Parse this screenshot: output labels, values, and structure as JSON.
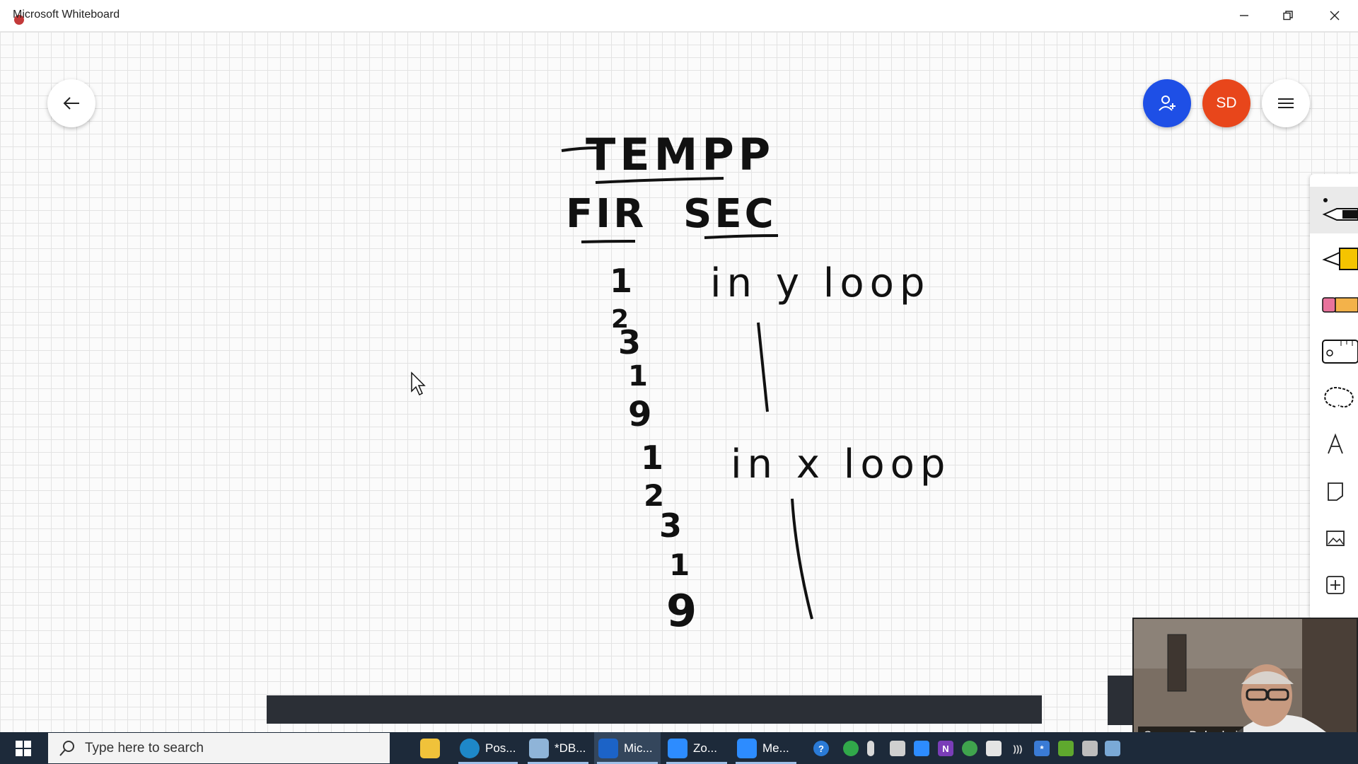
{
  "window": {
    "title": "Microsoft Whiteboard"
  },
  "canvas": {
    "ink": {
      "heading": "TEMPP",
      "col1": "FIR",
      "col2": "SEC",
      "y_loop_label": "in y loop",
      "x_loop_label": "in x loop",
      "values": [
        "1",
        "2",
        "3",
        "1",
        "9",
        "1",
        "2",
        "3",
        "1",
        "9"
      ]
    }
  },
  "top_controls": {
    "back_icon": "arrow-left-icon",
    "invite_icon": "person-add-icon",
    "avatar_initials": "SD",
    "menu_icon": "hamburger-icon"
  },
  "toolbar": {
    "tools": [
      "pen",
      "highlighter",
      "eraser",
      "ruler",
      "lasso",
      "text",
      "note",
      "image",
      "insert"
    ]
  },
  "video": {
    "participant_name": "Sameer Dehadrai"
  },
  "taskbar": {
    "search_placeholder": "Type here to search",
    "apps": [
      {
        "label": "Pos...",
        "icon": "edge-icon"
      },
      {
        "label": "*DB...",
        "icon": "notepad-icon"
      },
      {
        "label": "Mic...",
        "icon": "whiteboard-icon",
        "active": true
      },
      {
        "label": "Zo...",
        "icon": "zoom-icon"
      },
      {
        "label": "Me...",
        "icon": "zoom-meeting-icon"
      }
    ]
  },
  "colors": {
    "invite": "#1e4fe6",
    "avatar": "#e8461b",
    "taskbar": "#1d2a3a"
  }
}
